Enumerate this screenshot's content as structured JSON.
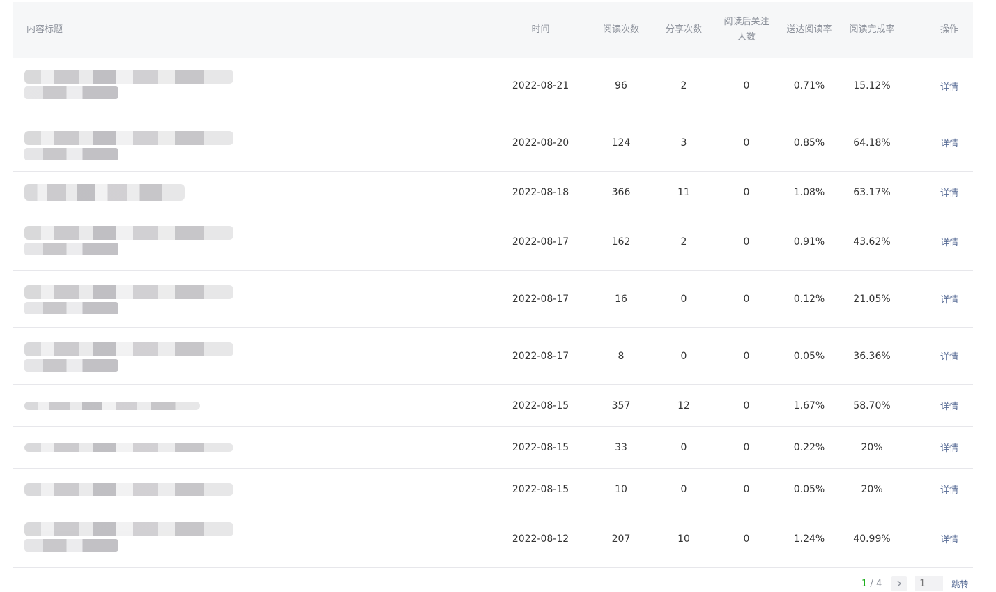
{
  "columns": {
    "title": "内容标题",
    "time": "时间",
    "reads": "阅读次数",
    "shares": "分享次数",
    "follow": "阅读后关注人数",
    "send_rate": "送达阅读率",
    "completion": "阅读完成率",
    "action": "操作"
  },
  "rows": [
    {
      "time": "2022-08-21",
      "reads": "96",
      "shares": "2",
      "follow": "0",
      "send_rate": "0.71%",
      "completion": "15.12%",
      "action": "详情"
    },
    {
      "time": "2022-08-20",
      "reads": "124",
      "shares": "3",
      "follow": "0",
      "send_rate": "0.85%",
      "completion": "64.18%",
      "action": "详情"
    },
    {
      "time": "2022-08-18",
      "reads": "366",
      "shares": "11",
      "follow": "0",
      "send_rate": "1.08%",
      "completion": "63.17%",
      "action": "详情"
    },
    {
      "time": "2022-08-17",
      "reads": "162",
      "shares": "2",
      "follow": "0",
      "send_rate": "0.91%",
      "completion": "43.62%",
      "action": "详情"
    },
    {
      "time": "2022-08-17",
      "reads": "16",
      "shares": "0",
      "follow": "0",
      "send_rate": "0.12%",
      "completion": "21.05%",
      "action": "详情"
    },
    {
      "time": "2022-08-17",
      "reads": "8",
      "shares": "0",
      "follow": "0",
      "send_rate": "0.05%",
      "completion": "36.36%",
      "action": "详情"
    },
    {
      "time": "2022-08-15",
      "reads": "357",
      "shares": "12",
      "follow": "0",
      "send_rate": "1.67%",
      "completion": "58.70%",
      "action": "详情"
    },
    {
      "time": "2022-08-15",
      "reads": "33",
      "shares": "0",
      "follow": "0",
      "send_rate": "0.22%",
      "completion": "20%",
      "action": "详情"
    },
    {
      "time": "2022-08-15",
      "reads": "10",
      "shares": "0",
      "follow": "0",
      "send_rate": "0.05%",
      "completion": "20%",
      "action": "详情"
    },
    {
      "time": "2022-08-12",
      "reads": "207",
      "shares": "10",
      "follow": "0",
      "send_rate": "1.24%",
      "completion": "40.99%",
      "action": "详情"
    }
  ],
  "pagination": {
    "current": "1",
    "separator": " / ",
    "total": "4",
    "next_icon": "chevron-right-icon",
    "input_placeholder": "1",
    "jump_label": "跳转"
  },
  "colors": {
    "header_bg": "#f6f7f8",
    "link": "#576b95",
    "current_page": "#1aad19"
  }
}
